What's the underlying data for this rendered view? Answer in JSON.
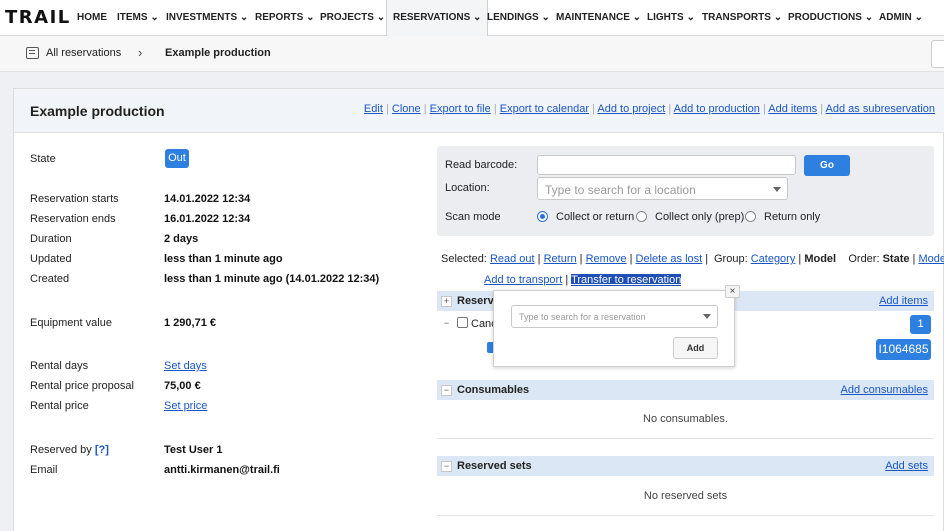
{
  "nav": {
    "logo": "TRAIL",
    "items": [
      "HOME",
      "ITEMS",
      "INVESTMENTS",
      "REPORTS",
      "PROJECTS",
      "RESERVATIONS",
      "LENDINGS",
      "MAINTENANCE",
      "LIGHTS",
      "TRANSPORTS",
      "PRODUCTIONS",
      "ADMIN"
    ],
    "active": "RESERVATIONS"
  },
  "breadcrumb": {
    "all": "All reservations",
    "current": "Example production"
  },
  "header": {
    "title": "Example production",
    "actions": [
      "Edit",
      "Clone",
      "Export to file",
      "Export to calendar",
      "Add to project",
      "Add to production",
      "Add items",
      "Add as subreservation"
    ]
  },
  "details": {
    "state_label": "State",
    "state_value": "Out",
    "starts_label": "Reservation starts",
    "starts_value": "14.01.2022 12:34",
    "ends_label": "Reservation ends",
    "ends_value": "16.01.2022 12:34",
    "duration_label": "Duration",
    "duration_value": "2 days",
    "updated_label": "Updated",
    "updated_value": "less than 1 minute ago",
    "created_label": "Created",
    "created_value": "less than 1 minute ago (14.01.2022 12:34)",
    "equip_label": "Equipment value",
    "equip_value": "1 290,71 €",
    "rental_days_label": "Rental days",
    "rental_days_value": "Set days",
    "proposal_label": "Rental price proposal",
    "proposal_value": "75,00 €",
    "rental_price_label": "Rental price",
    "rental_price_value": "Set price",
    "reserved_by_label": "Reserved by",
    "reserved_by_help": "[?]",
    "reserved_by_value": "Test User 1",
    "email_label": "Email",
    "email_value": "antti.kirmanen@trail.fi"
  },
  "scan": {
    "barcode_label": "Read barcode:",
    "go": "Go",
    "location_label": "Location:",
    "location_placeholder": "Type to search for a location",
    "mode_label": "Scan mode",
    "modes": [
      "Collect or return",
      "Collect only (prep)",
      "Return only"
    ],
    "selected_mode": "Collect or return"
  },
  "selected": {
    "label": "Selected:",
    "actions": [
      "Read out",
      "Return",
      "Remove",
      "Delete as lost"
    ],
    "group_label": "Group:",
    "group_category": "Category",
    "group_model": "Model",
    "order_label": "Order:",
    "order_state": "State",
    "order_model": "Model",
    "actions2": [
      "Add to transport",
      "Transfer to reservation"
    ]
  },
  "reserved": {
    "title": "Reserv",
    "add_label": "Add items",
    "row_text": "Canc",
    "count": "1",
    "code": "I1064685"
  },
  "consumables": {
    "title": "Consumables",
    "add_label": "Add consumables",
    "empty": "No consumables."
  },
  "sets": {
    "title": "Reserved sets",
    "add_label": "Add sets",
    "empty": "No reserved sets"
  },
  "popup": {
    "placeholder": "Type to search for a reservation",
    "add": "Add",
    "close": "×"
  },
  "colors": {
    "accent": "#2d7fe0",
    "link": "#1a56c4",
    "section": "#dbe7f4"
  }
}
